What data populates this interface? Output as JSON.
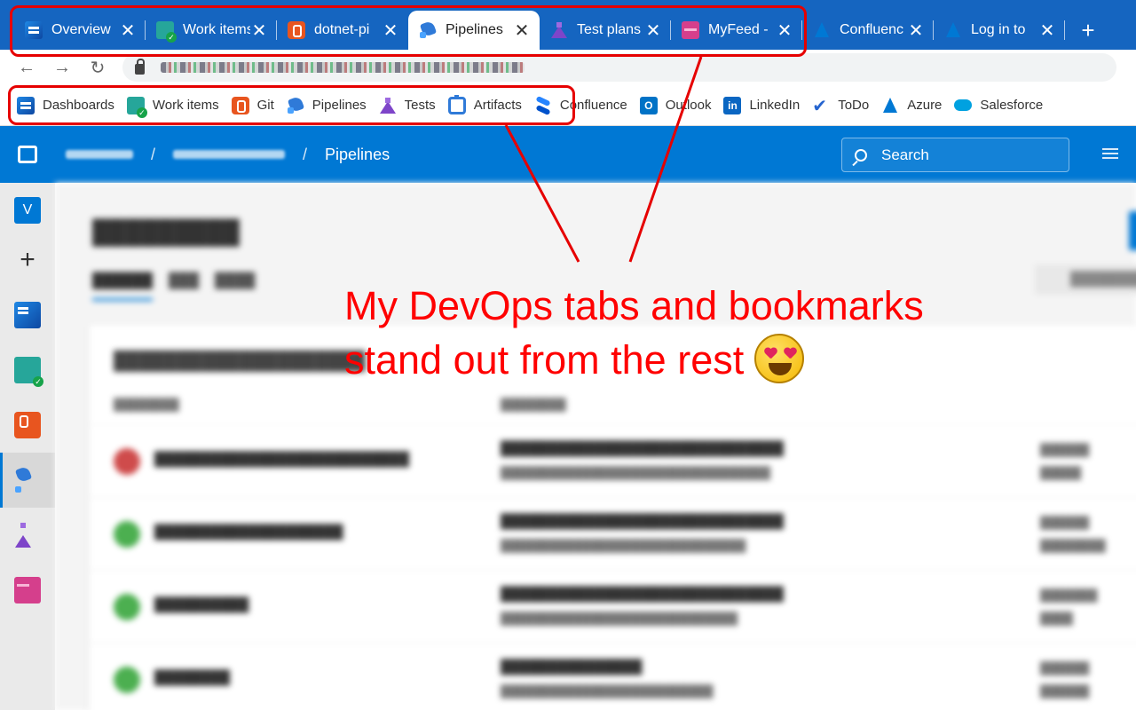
{
  "browser": {
    "tabs": [
      {
        "title": "Overview",
        "icon": "dashboards-icon",
        "active": false
      },
      {
        "title": "Work items",
        "icon": "work-items-icon",
        "active": false
      },
      {
        "title": "dotnet-pi",
        "icon": "git-icon",
        "active": false
      },
      {
        "title": "Pipelines",
        "icon": "pipelines-icon",
        "active": true
      },
      {
        "title": "Test plans",
        "icon": "test-plans-icon",
        "active": false
      },
      {
        "title": "MyFeed -",
        "icon": "artifacts-feed-icon",
        "active": false
      },
      {
        "title": "Confluenc",
        "icon": "confluence-icon",
        "active": false
      },
      {
        "title": "Log in to",
        "icon": "azure-icon",
        "active": false
      }
    ],
    "close_glyph": "✕",
    "new_tab_glyph": "+",
    "nav": {
      "back": "←",
      "forward": "→",
      "reload": "↻"
    }
  },
  "bookmarks": [
    {
      "label": "Dashboards",
      "icon": "dashboards-icon"
    },
    {
      "label": "Work items",
      "icon": "work-items-icon"
    },
    {
      "label": "Git",
      "icon": "git-icon"
    },
    {
      "label": "Pipelines",
      "icon": "pipelines-icon"
    },
    {
      "label": "Tests",
      "icon": "test-plans-icon"
    },
    {
      "label": "Artifacts",
      "icon": "artifacts-icon"
    },
    {
      "label": "Confluence",
      "icon": "confluence-icon"
    },
    {
      "label": "Outlook",
      "icon": "outlook-icon"
    },
    {
      "label": "LinkedIn",
      "icon": "linkedin-icon"
    },
    {
      "label": "ToDo",
      "icon": "todo-icon"
    },
    {
      "label": "Azure",
      "icon": "azure-icon"
    },
    {
      "label": "Salesforce",
      "icon": "salesforce-icon"
    }
  ],
  "ado": {
    "breadcrumb_current": "Pipelines",
    "breadcrumb_sep": "/",
    "search_placeholder": "Search",
    "rail_avatar": "V",
    "rail_add": "+",
    "accent": "#0078d4"
  },
  "annotation": {
    "line1": "My DevOps tabs and bookmarks",
    "line2": "stand out from the rest",
    "color": "#e60000"
  }
}
